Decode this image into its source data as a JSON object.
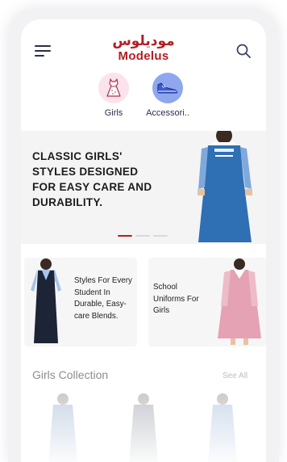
{
  "header": {
    "logo_arabic": "موديلوس",
    "logo_english": "Modelus",
    "menu_icon": "hamburger-menu-icon",
    "search_icon": "search-icon"
  },
  "categories": [
    {
      "label": "Girls",
      "icon": "dress-icon",
      "color": "#fbe3ec"
    },
    {
      "label": "Accessori..",
      "icon": "shoe-icon",
      "color": "#8ea7ef"
    }
  ],
  "hero": {
    "text": "CLASSIC GIRLS' STYLES DESIGNED FOR EASY CARE AND DURABILITY.",
    "active_slide": 1,
    "slide_count": 3
  },
  "promos": [
    {
      "text": "Styles For Every Student In Durable, Easy-care Blends."
    },
    {
      "text": "School Uniforms For Girls"
    }
  ],
  "collection": {
    "title": "Girls Collection",
    "see_all": "See All"
  },
  "colors": {
    "brand": "#b41e24",
    "active_dot": "#b41e24"
  }
}
